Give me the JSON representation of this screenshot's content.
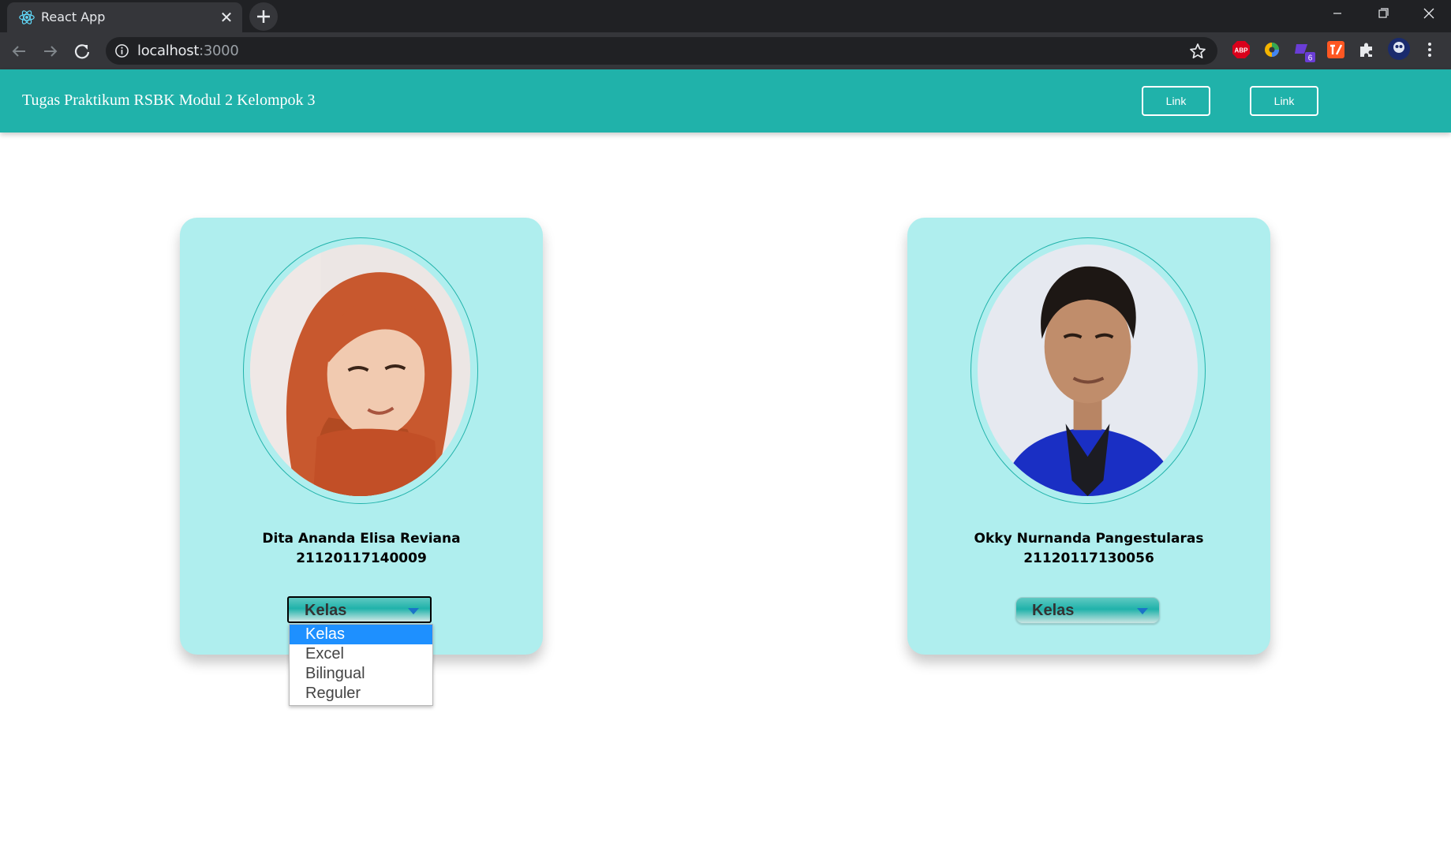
{
  "browser": {
    "tab_title": "React App",
    "tab_icon": "react-logo-icon",
    "close_glyph": "✕",
    "url_host": "localhost",
    "url_port": ":3000",
    "extensions": [
      "adblock-plus-icon",
      "color-picker-icon",
      "extension-badge-icon",
      "tampermonkey-icon",
      "puzzle-extensions-icon",
      "profile-avatar-icon"
    ],
    "extension_badge_count": "6",
    "adblock_label": "ABP"
  },
  "navbar": {
    "brand": "Tugas Praktikum RSBK Modul 2 Kelompok 3",
    "links": [
      "Link",
      "Link"
    ],
    "color": "#20b2aa"
  },
  "cards": [
    {
      "name": "Dita Ananda Elisa Reviana",
      "nim": "21120117140009",
      "select_value": "Kelas",
      "photo": "portrait-woman-orange-hijab"
    },
    {
      "name": "Okky Nurnanda Pangestularas",
      "nim": "21120117130056",
      "select_value": "Kelas",
      "photo": "portrait-man-blue-shirt"
    }
  ],
  "dropdown": {
    "options": [
      "Kelas",
      "Excel",
      "Bilingual",
      "Reguler"
    ],
    "selected_index": 0
  },
  "colors": {
    "card_bg": "#afeeee",
    "accent": "#20b2aa",
    "option_highlight": "#1e90ff"
  }
}
